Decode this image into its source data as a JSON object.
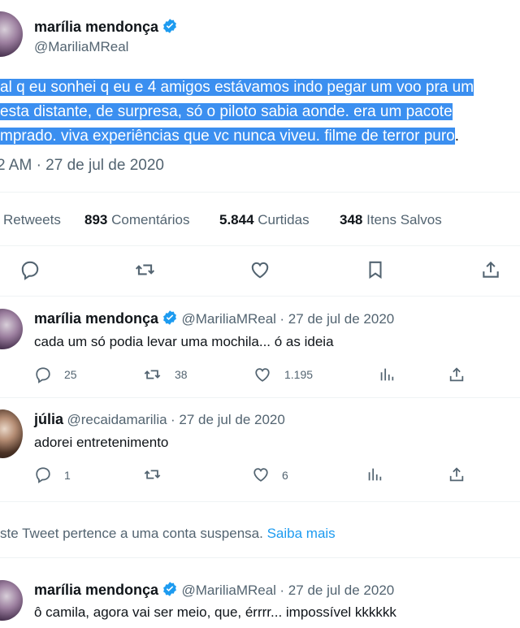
{
  "main_tweet": {
    "author": "marília mendonça",
    "handle": "@MariliaMReal",
    "text_lines": [
      "al q eu sonhei q eu e 4 amigos estávamos indo pegar um voo pra um",
      "esta distante, de surpresa, só o piloto sabia aonde. era um pacote",
      "mprado. viva experiências que vc nunca viveu. filme de terror puro",
      "."
    ],
    "timestamp": "2 AM · 27 de jul de 2020",
    "stats": [
      {
        "num": "",
        "label": "Retweets"
      },
      {
        "num": "893",
        "label": "Comentários"
      },
      {
        "num": "5.844",
        "label": "Curtidas"
      },
      {
        "num": "348",
        "label": "Itens Salvos"
      }
    ]
  },
  "replies": [
    {
      "author": "marília mendonça",
      "handle": "@MariliaMReal",
      "date": "· 27 de jul de 2020",
      "text": "cada um só podia levar uma mochila... ó as ideia",
      "reply_count": "25",
      "retweet_count": "38",
      "like_count": "1.195"
    },
    {
      "author": "júlia",
      "handle": "@recaidamarilia",
      "date": "· 27 de jul de 2020",
      "text": "adorei entretenimento",
      "reply_count": "1",
      "retweet_count": "",
      "like_count": "6"
    },
    {
      "author": "marília mendonça",
      "handle": "@MariliaMReal",
      "date": "· 27 de jul de 2020",
      "text": "ô camila, agora vai ser meio, que, érrrr... impossível kkkkkk"
    }
  ],
  "suspended_notice": {
    "text": "ste Tweet pertence a uma conta suspensa.",
    "link": "Saiba mais"
  },
  "colors": {
    "accent": "#1d9bf0",
    "selection": "#3b8ff0",
    "muted": "#536471"
  }
}
